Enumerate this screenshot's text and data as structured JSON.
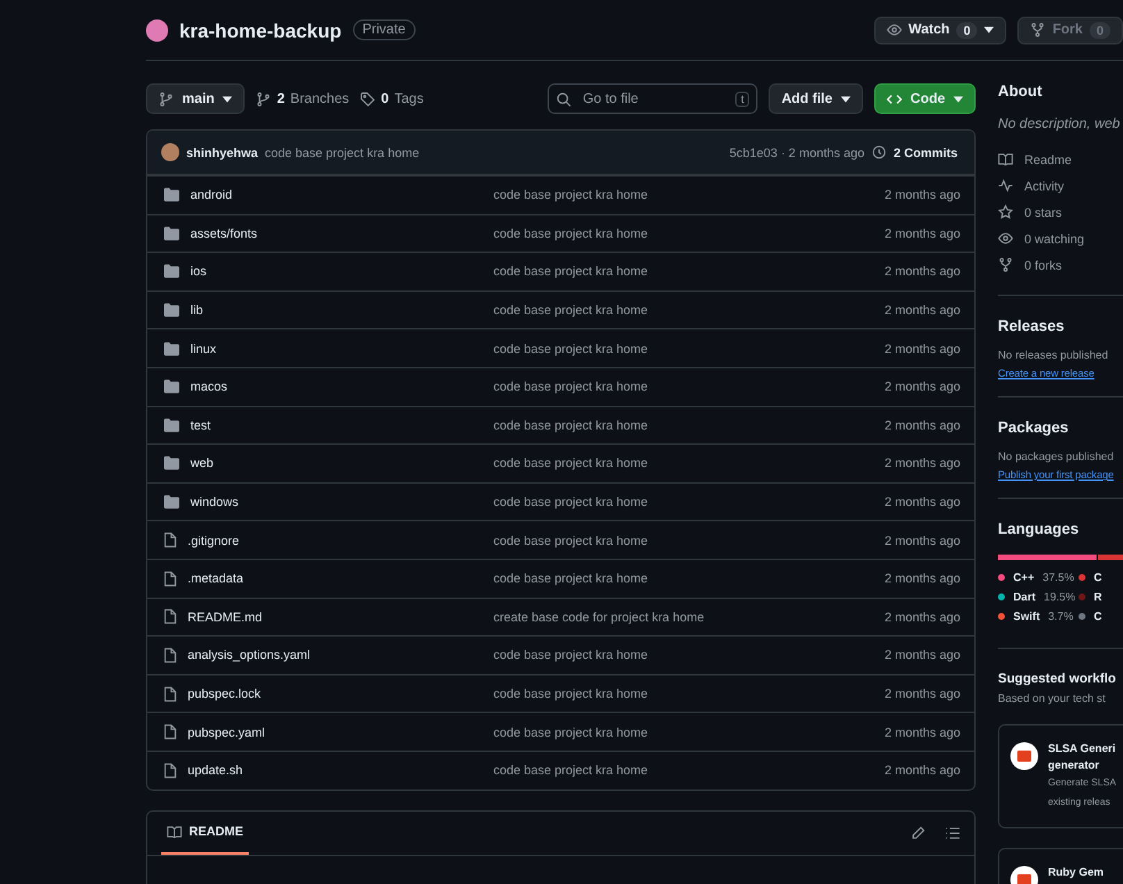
{
  "repo": {
    "name": "kra-home-backup",
    "visibility": "Private"
  },
  "header_buttons": [
    {
      "label": "Watch",
      "count": "0",
      "disabled": false
    },
    {
      "label": "Fork",
      "count": "0",
      "disabled": true
    }
  ],
  "toolbar": {
    "branch": "main",
    "branches_count": "2",
    "branches_label": "Branches",
    "tags_count": "0",
    "tags_label": "Tags",
    "search": {
      "placeholder": "Go to file",
      "shortcut": "t"
    },
    "add_file": "Add file",
    "code": "Code"
  },
  "commit": {
    "author": "shinhyehwa",
    "message": "code base project kra home",
    "meta": "5cb1e03 · 2 months ago",
    "commits": "2 Commits"
  },
  "files": [
    {
      "kind": "folder",
      "name": "android",
      "message": "code base project kra home",
      "time": "2 months ago"
    },
    {
      "kind": "folder",
      "name": "assets/fonts",
      "message": "code base project kra home",
      "time": "2 months ago"
    },
    {
      "kind": "folder",
      "name": "ios",
      "message": "code base project kra home",
      "time": "2 months ago"
    },
    {
      "kind": "folder",
      "name": "lib",
      "message": "code base project kra home",
      "time": "2 months ago"
    },
    {
      "kind": "folder",
      "name": "linux",
      "message": "code base project kra home",
      "time": "2 months ago"
    },
    {
      "kind": "folder",
      "name": "macos",
      "message": "code base project kra home",
      "time": "2 months ago"
    },
    {
      "kind": "folder",
      "name": "test",
      "message": "code base project kra home",
      "time": "2 months ago"
    },
    {
      "kind": "folder",
      "name": "web",
      "message": "code base project kra home",
      "time": "2 months ago"
    },
    {
      "kind": "folder",
      "name": "windows",
      "message": "code base project kra home",
      "time": "2 months ago"
    },
    {
      "kind": "file",
      "name": ".gitignore",
      "message": "code base project kra home",
      "time": "2 months ago"
    },
    {
      "kind": "file",
      "name": ".metadata",
      "message": "code base project kra home",
      "time": "2 months ago"
    },
    {
      "kind": "file",
      "name": "README.md",
      "message": "create base code for project kra home",
      "time": "2 months ago"
    },
    {
      "kind": "file",
      "name": "analysis_options.yaml",
      "message": "code base project kra home",
      "time": "2 months ago"
    },
    {
      "kind": "file",
      "name": "pubspec.lock",
      "message": "code base project kra home",
      "time": "2 months ago"
    },
    {
      "kind": "file",
      "name": "pubspec.yaml",
      "message": "code base project kra home",
      "time": "2 months ago"
    },
    {
      "kind": "file",
      "name": "update.sh",
      "message": "code base project kra home",
      "time": "2 months ago"
    }
  ],
  "readme": {
    "tab": "README",
    "selected": true
  },
  "about": {
    "title": "About",
    "description": "No description, web",
    "links": [
      {
        "kind": "book",
        "label": "Readme"
      },
      {
        "kind": "pulse",
        "label": "Activity"
      },
      {
        "kind": "star",
        "label": "0 stars"
      },
      {
        "kind": "eye",
        "label": "0 watching"
      },
      {
        "kind": "fork",
        "label": "0 forks"
      }
    ]
  },
  "releases": {
    "title": "Releases",
    "note": "No releases published",
    "link": "Create a new release"
  },
  "packages": {
    "title": "Packages",
    "note": "No packages published",
    "link": "Publish your first package"
  },
  "languages": {
    "title": "Languages",
    "bar": [
      {
        "color": "#f34b7d",
        "level": 0.8
      },
      {
        "color": "#da3434",
        "level": 0.2
      }
    ],
    "items": [
      {
        "name": "C++",
        "percent": "37.5%",
        "color": "#f34b7d"
      },
      {
        "name": "C",
        "color": "#da3434"
      },
      {
        "name": "Dart",
        "percent": "19.5%",
        "color": "#00b4ab"
      },
      {
        "name": "R",
        "color": "#701516"
      },
      {
        "name": "Swift",
        "percent": "3.7%",
        "color": "#f05138"
      },
      {
        "name": "C",
        "color": "#6e7681"
      }
    ]
  },
  "workflows": {
    "title": "Suggested workflo",
    "subtitle": "Based on your tech st",
    "cards": [
      {
        "title": "SLSA Generi",
        "title_line2": "generator",
        "description": "Generate SLSA",
        "description_line2": "existing releas"
      },
      {
        "title": "Ruby Gem"
      }
    ]
  }
}
